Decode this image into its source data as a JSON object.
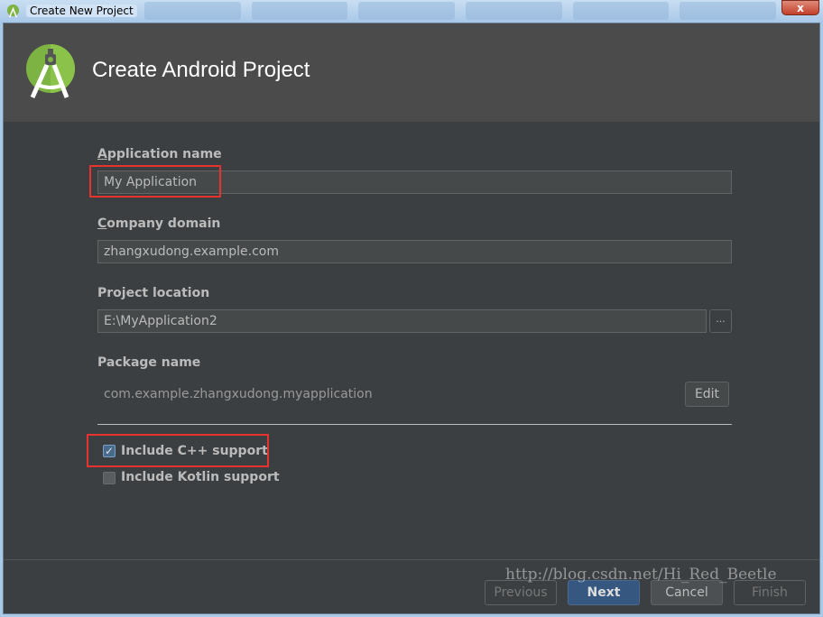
{
  "window": {
    "title": "Create New Project",
    "close_label": "x"
  },
  "header": {
    "title": "Create Android Project",
    "logo_icon": "android-studio-logo"
  },
  "form": {
    "app_name": {
      "label_u": "A",
      "label_rest": "pplication name",
      "value": "My Application"
    },
    "company_domain": {
      "label_u": "C",
      "label_rest": "ompany domain",
      "value": "zhangxudong.example.com"
    },
    "project_location": {
      "label": "Project location",
      "value": "E:\\MyApplication2",
      "browse_label": "..."
    },
    "package_name": {
      "label": "Package name",
      "value": "com.example.zhangxudong.myapplication",
      "edit_label": "Edit"
    },
    "cpp_support": {
      "label": "Include C++ support",
      "checked": true
    },
    "kotlin_support": {
      "label": "Include Kotlin support",
      "checked": false
    }
  },
  "footer": {
    "previous": "Previous",
    "next": "Next",
    "cancel": "Cancel",
    "finish": "Finish"
  },
  "watermark": "http://blog.csdn.net/Hi_Red_Beetle",
  "colors": {
    "background": "#3c3f41",
    "header": "#4b4b4b",
    "accent": "#365880",
    "highlight": "#e8322e"
  }
}
